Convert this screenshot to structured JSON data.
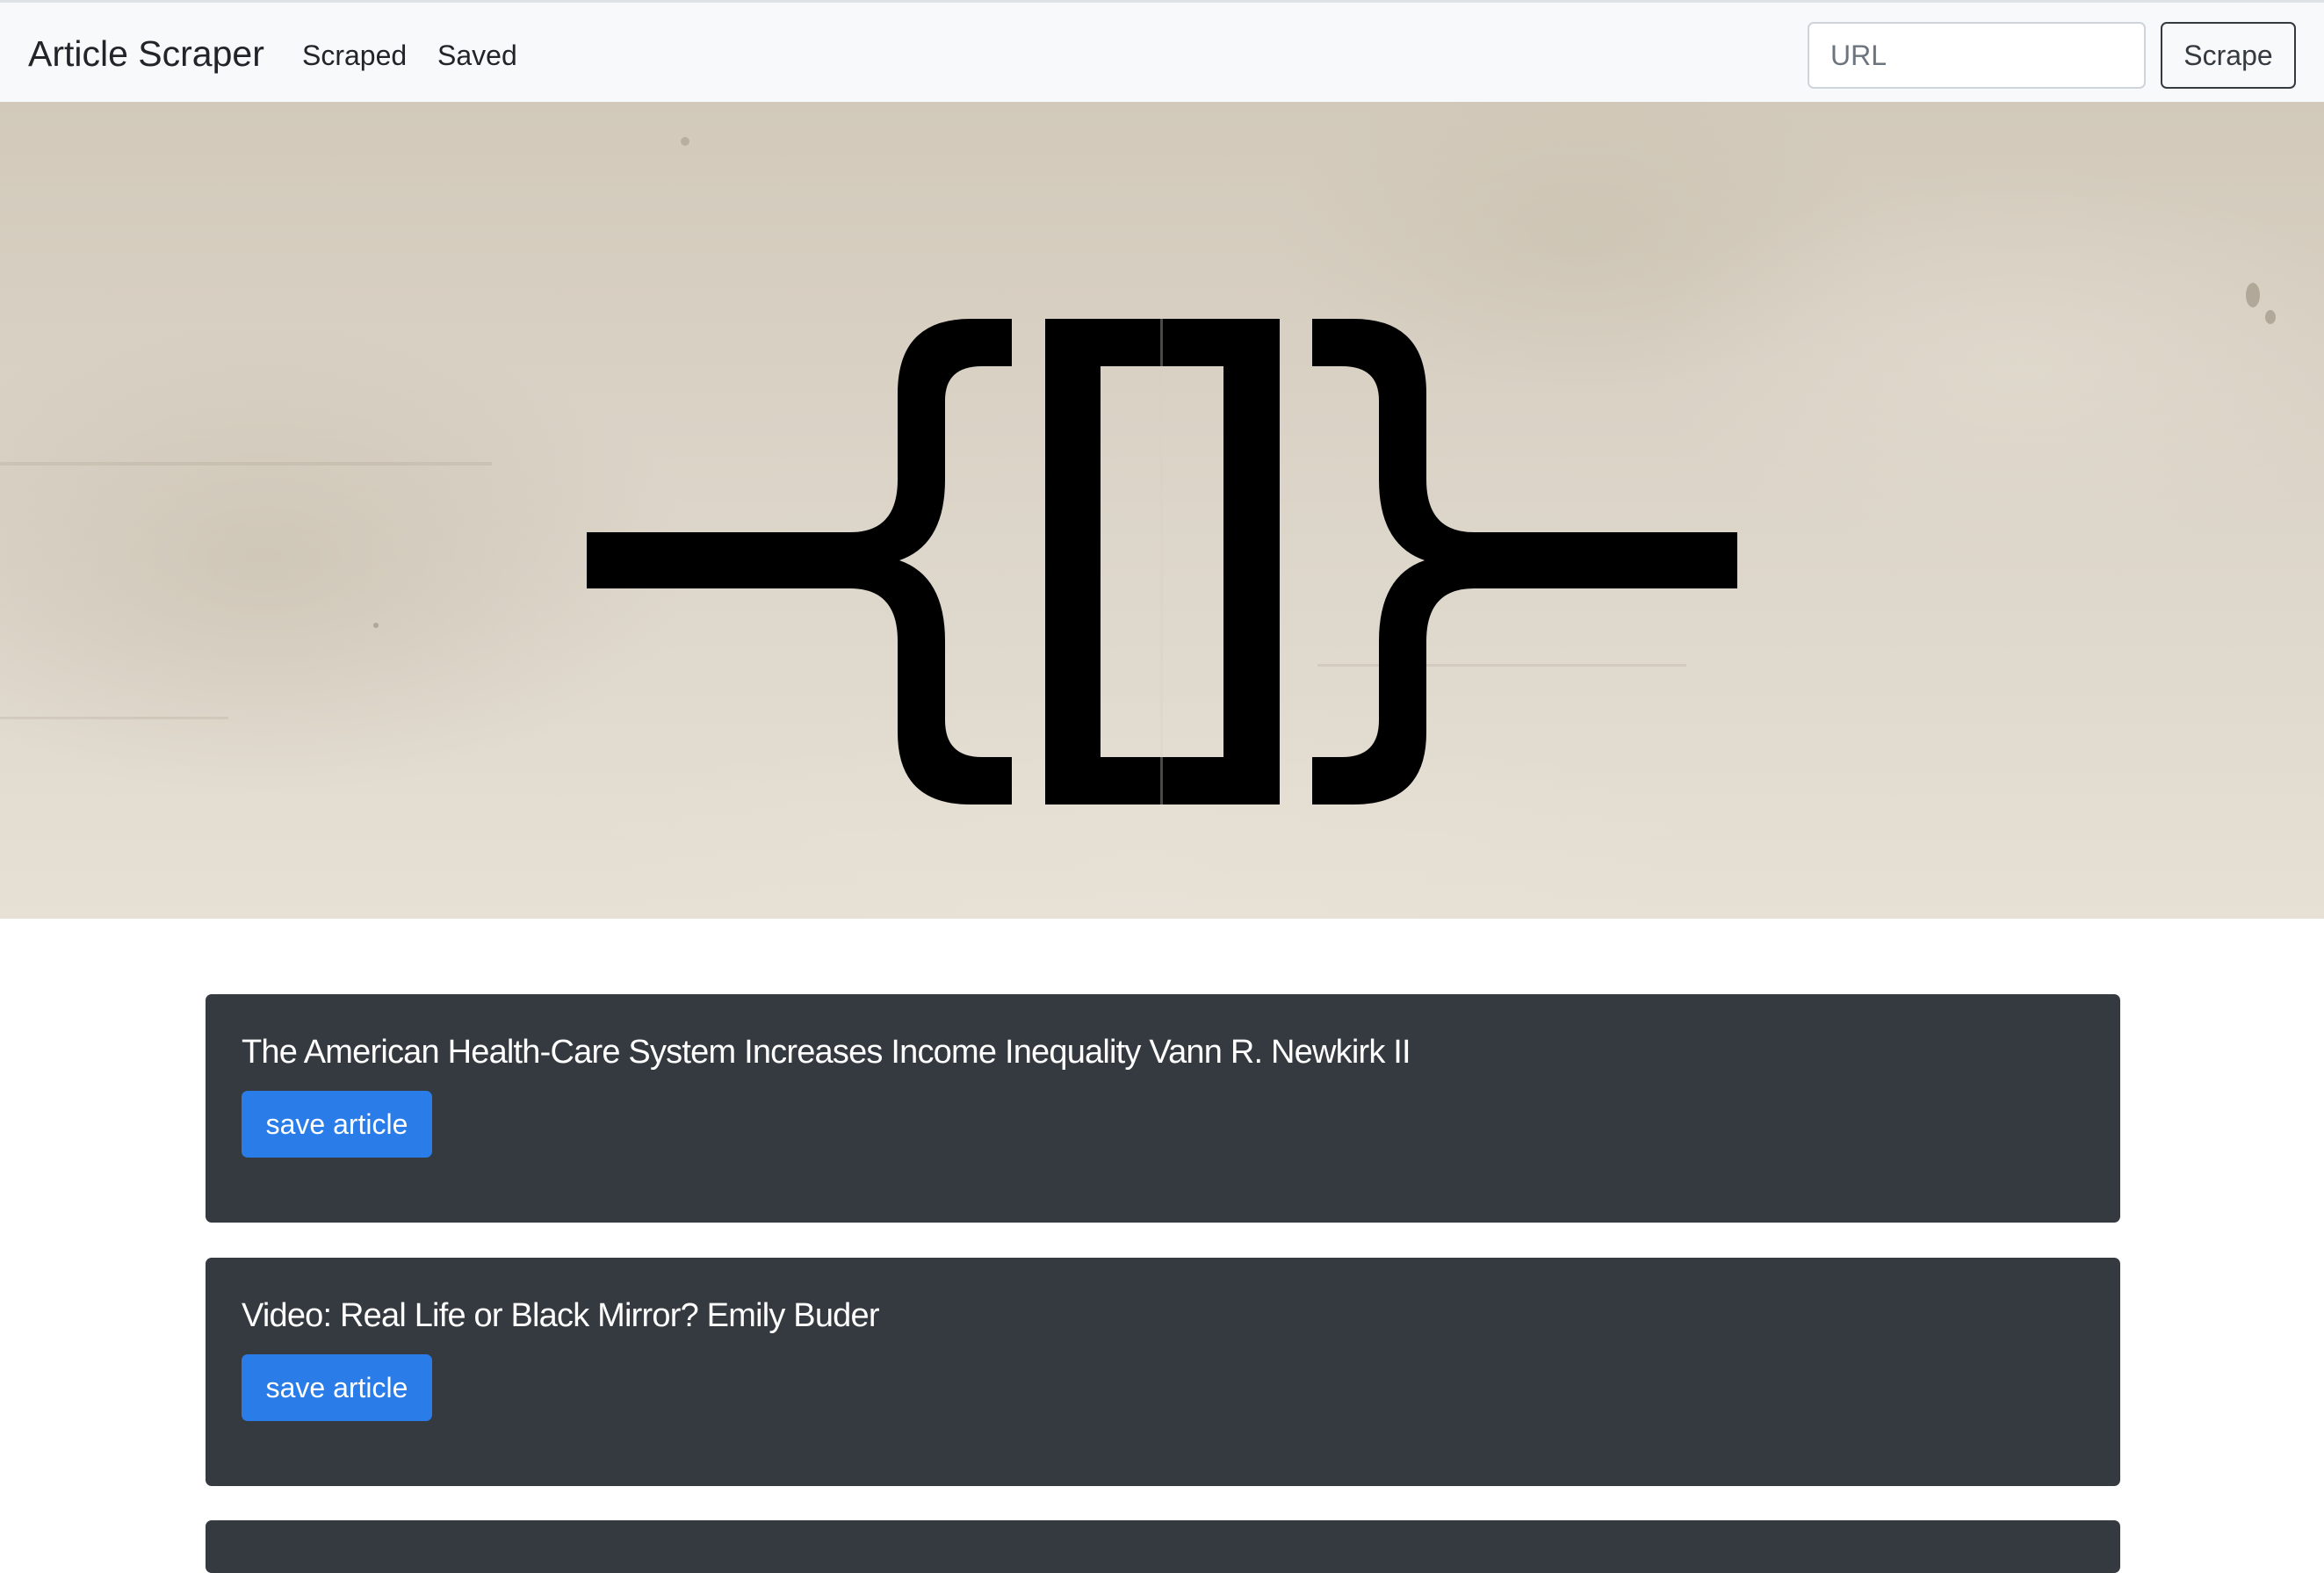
{
  "navbar": {
    "brand": "Article Scraper",
    "links": [
      {
        "label": "Scraped"
      },
      {
        "label": "Saved"
      }
    ],
    "url_input": {
      "placeholder": "URL",
      "value": ""
    },
    "scrape_button_label": "Scrape"
  },
  "hero": {
    "logo_icon": "curly-brace-bracket-logo-icon",
    "background": "aged-paper-texture"
  },
  "articles": [
    {
      "title": "The American Health-Care System Increases Income Inequality Vann R. Newkirk II",
      "save_label": "save article"
    },
    {
      "title": "Video: Real Life or Black Mirror? Emily Buder",
      "save_label": "save article"
    }
  ],
  "colors": {
    "card_background": "#343a40",
    "save_button": "#2a7ce8",
    "navbar_background": "#f8f9fa"
  }
}
